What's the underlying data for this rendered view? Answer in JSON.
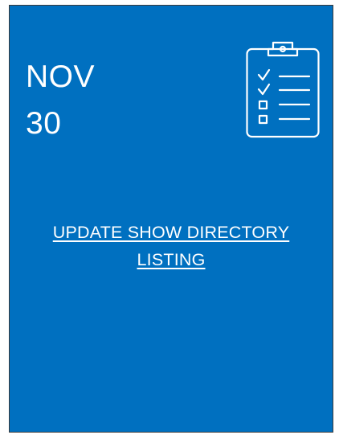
{
  "card": {
    "month": "NOV",
    "day": "30",
    "task_line1": "UPDATE SHOW DIRECTORY",
    "task_line2": "LISTING",
    "icon": "clipboard-checklist-icon",
    "background_color": "#0070c0",
    "text_color": "#ffffff"
  }
}
